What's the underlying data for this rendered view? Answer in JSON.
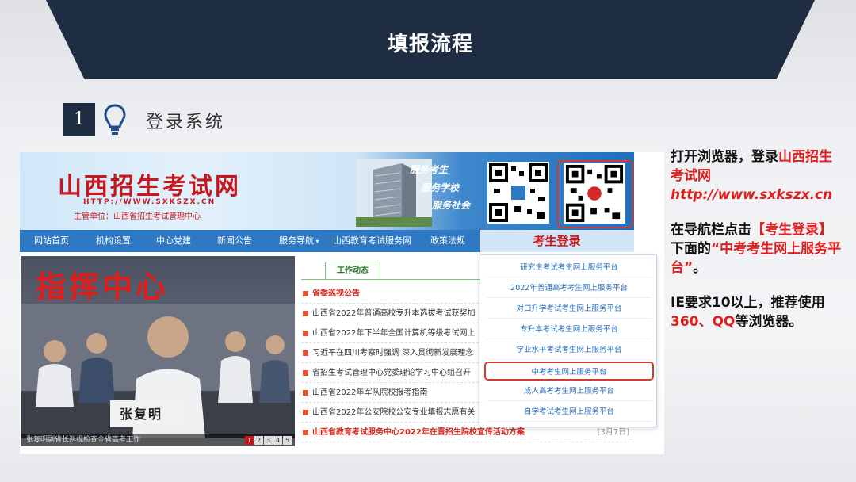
{
  "slide": {
    "title": "填报流程",
    "step_number": "1",
    "step_title": "登录系统"
  },
  "site": {
    "name": "山西招生考试网",
    "url_banner": "HTTP://WWW.SXKSZX.CN",
    "sponsor": "主管单位：山西省招生考试管理中心",
    "slogans": [
      "服务考生",
      "服务学校",
      "服务社会"
    ],
    "nav": [
      "网站首页",
      "机构设置",
      "中心党建",
      "新闻公告",
      "服务导航",
      "山西教育考试服务网",
      "政策法规"
    ],
    "nav_login": "考生登录",
    "photo_sign": "指挥中心",
    "photo_caption": "张复明副省长巡视检查全省高考工作",
    "nameplate": "张复明",
    "pager": [
      "1",
      "2",
      "3",
      "4",
      "5"
    ],
    "tab_label": "工作动态",
    "news": [
      {
        "text": "省委巡视公告",
        "red": true
      },
      {
        "text": "山西省2022年普通高校专升本选拔考试获奖加",
        "red": false
      },
      {
        "text": "山西省2022年下半年全国计算机等级考试网上",
        "red": false
      },
      {
        "text": "习近平在四川考察时强调 深入贯彻新发展理念",
        "red": false
      },
      {
        "text": "省招生考试管理中心党委理论学习中心组召开",
        "red": false
      },
      {
        "text": "山西省2022年军队院校报考指南",
        "red": false
      },
      {
        "text": "山西省2022年公安院校公安专业填报志愿有关",
        "red": false
      },
      {
        "text": "山西省教育考试服务中心2022年在晋招生院校宣传活动方案",
        "red": true,
        "date": "[3月7日]"
      }
    ],
    "dropdown": [
      "研究生考试考生网上服务平台",
      "2022年普通高考考生网上服务平台",
      "对口升学考试考生网上服务平台",
      "专升本考试考生网上服务平台",
      "学业水平考试考生网上服务平台",
      "中考考生网上服务平台",
      "成人高考考生网上服务平台",
      "自学考试考生网上服务平台"
    ],
    "dropdown_highlight_index": 5
  },
  "instructions": {
    "p1_prefix": "打开浏览器，登录",
    "p1_site": "山西招生考试网",
    "p1_url": "http://www.sxkszx.cn",
    "p2_prefix": "在导航栏点击",
    "p2_login": "【考生登录】",
    "p2_mid": "下面的",
    "p2_target": "“中考考生网上服务平台”",
    "p2_suffix": "。",
    "p3_a": "IE要求10以上，推荐使用",
    "p3_browsers": "360、QQ",
    "p3_b": "等浏览器。"
  },
  "colors": {
    "banner": "#1f2d42",
    "accent_red": "#e01e1e",
    "nav_blue": "#2f78c4"
  }
}
